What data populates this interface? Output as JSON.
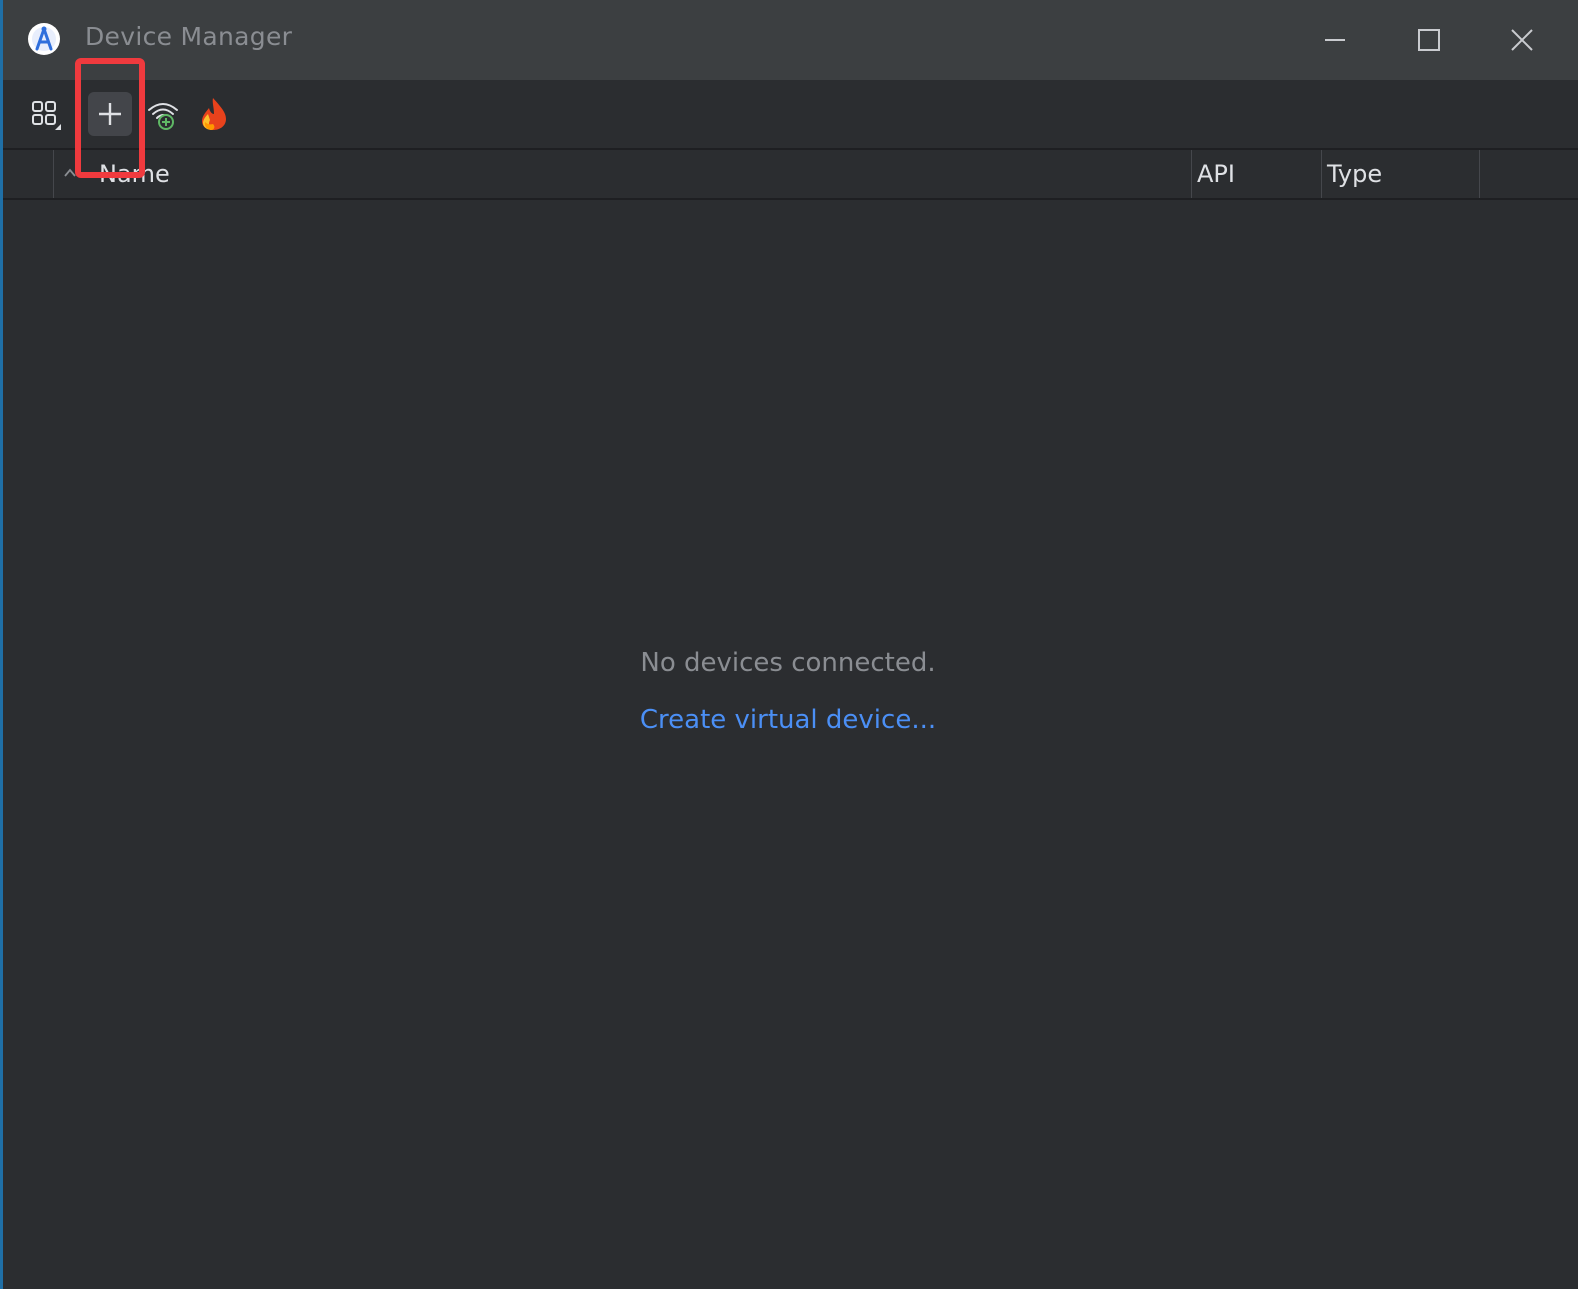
{
  "window": {
    "title": "Device Manager"
  },
  "toolbar": {
    "items": [
      {
        "name": "device-layout-menu",
        "icon": "grid-icon"
      },
      {
        "name": "create-device",
        "icon": "plus-icon"
      },
      {
        "name": "pair-wifi",
        "icon": "wifi-plus-icon"
      },
      {
        "name": "firebase",
        "icon": "firebase-icon"
      }
    ]
  },
  "table": {
    "columns": [
      "Name",
      "API",
      "Type"
    ]
  },
  "empty_state": {
    "message": "No devices connected.",
    "link": "Create virtual device..."
  },
  "colors": {
    "titlebar": "#3c3f41",
    "background": "#2b2d30",
    "link": "#4b8ff5",
    "highlight": "#f03a3e",
    "wifi_accent": "#5fb865"
  }
}
